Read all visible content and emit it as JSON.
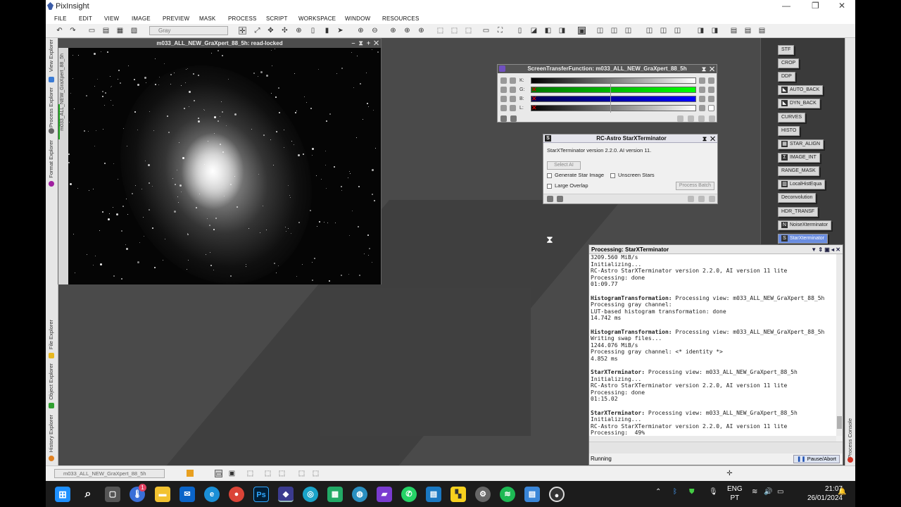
{
  "app": {
    "title": "PixInsight",
    "menu": [
      "FILE",
      "EDIT",
      "VIEW",
      "IMAGE",
      "PREVIEW",
      "MASK",
      "PROCESS",
      "SCRIPT",
      "WORKSPACE",
      "WINDOW",
      "RESOURCES"
    ],
    "view_select": "Gray"
  },
  "left_tabs": [
    "View Explorer",
    "m033_ALL_NEW_GraXpert_88_5h",
    "Process Explorer",
    "Format Explorer",
    "File Explorer",
    "Object Explorer",
    "History Explorer"
  ],
  "image_window": {
    "title": "m033_ALL_NEW_GraXpert_88_5h: read-locked"
  },
  "stf": {
    "title": "ScreenTransferFunction: m033_ALL_NEW_GraXpert_88_5h",
    "channels": [
      "K:",
      "G:",
      "B:",
      "L:"
    ]
  },
  "starx": {
    "title": "RC-Astro StarXTerminator",
    "version_text": "StarXTerminator version 2.2.0. AI version 11.",
    "select_ai": "Select AI",
    "generate_star_image": "Generate Star Image",
    "unscreen_stars": "Unscreen Stars",
    "large_overlap": "Large Overlap",
    "process_batch": "Process Batch"
  },
  "icons": [
    "STF",
    "CROP",
    "DDP",
    "AUTO_BACK",
    "DYN_BACK",
    "CURVES",
    "HISTO",
    "STAR_ALIGN",
    "IMAGE_INT",
    "RANGE_MASK",
    "LocalHistEqua",
    "Deconvolution",
    "HDR_TRANSF",
    "NoiseXterminator",
    "StarXterminator"
  ],
  "console": {
    "title": "Processing: StarXTerminator",
    "status": "Running",
    "pause_label": "Pause/Abort",
    "side_tab": "Process Console",
    "lines": [
      {
        "t": "3209.560 MiB/s"
      },
      {
        "t": "Initializing..."
      },
      {
        "t": "RC-Astro StarXTerminator version 2.2.0, AI version 11 lite"
      },
      {
        "t": "Processing: done"
      },
      {
        "t": "01:09.77"
      },
      {
        "t": ""
      },
      {
        "b": "HistogramTransformation:",
        "t": " Processing view: m033_ALL_NEW_GraXpert_88_5h"
      },
      {
        "t": "Processing gray channel:"
      },
      {
        "t": "LUT-based histogram transformation: done"
      },
      {
        "t": "14.742 ms"
      },
      {
        "t": ""
      },
      {
        "b": "HistogramTransformation:",
        "t": " Processing view: m033_ALL_NEW_GraXpert_88_5h"
      },
      {
        "t": "Writing swap files..."
      },
      {
        "t": "1244.076 MiB/s"
      },
      {
        "t": "Processing gray channel: <* identity *>"
      },
      {
        "t": "4.852 ms"
      },
      {
        "t": ""
      },
      {
        "b": "StarXTerminator:",
        "t": " Processing view: m033_ALL_NEW_GraXpert_88_5h"
      },
      {
        "t": "Initializing..."
      },
      {
        "t": "RC-Astro StarXTerminator version 2.2.0, AI version 11 lite"
      },
      {
        "t": "Processing: done"
      },
      {
        "t": "01:15.02"
      },
      {
        "t": ""
      },
      {
        "b": "StarXTerminator:",
        "t": " Processing view: m033_ALL_NEW_GraXpert_88_5h"
      },
      {
        "t": "Initializing..."
      },
      {
        "t": "RC-Astro StarXTerminator version 2.2.0, AI version 11 lite"
      },
      {
        "t": "Processing:  49%"
      }
    ]
  },
  "statusbar": {
    "view_name": "m033_ALL_NEW_GraXpert_88_5h"
  },
  "taskbar": {
    "badge": "1",
    "lang": "ENG",
    "lang2": "PT",
    "time": "21:07",
    "date": "26/01/2024",
    "ps": "Ps"
  }
}
